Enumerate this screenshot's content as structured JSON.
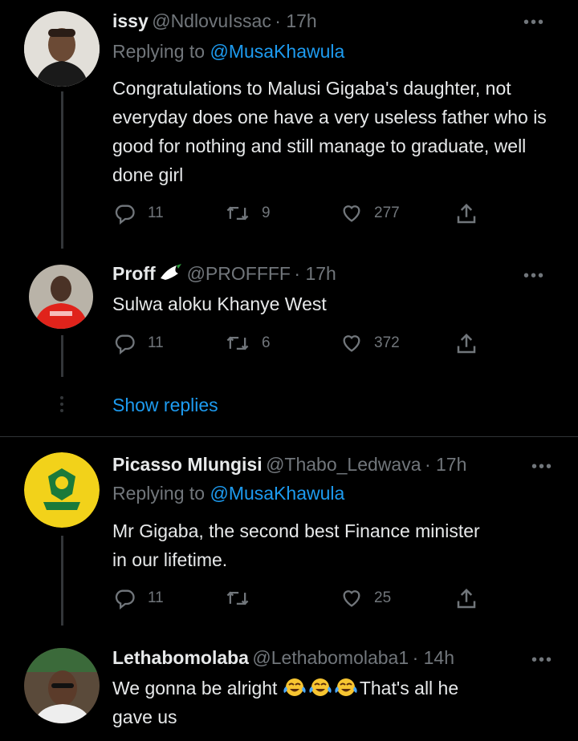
{
  "tweets": [
    {
      "name": "issy",
      "handle": "@NdlovuIssac",
      "time": "· 17h",
      "replying_prefix": "Replying to ",
      "replying_to": "@MusaKhawula",
      "text": "Congratulations to Malusi Gigaba's daughter, not everyday does one have a very useless father who is good for nothing and still manage to graduate, well done girl",
      "reply_count": "11",
      "retweet_count": "9",
      "like_count": "277"
    },
    {
      "name": "Proff",
      "handle": "@PROFFFF",
      "time": "· 17h",
      "text": "Sulwa aloku Khanye West",
      "reply_count": "11",
      "retweet_count": "6",
      "like_count": "372"
    },
    {
      "name": "Picasso Mlungisi",
      "handle": "@Thabo_Ledwava",
      "time": "· 17h",
      "replying_prefix": "Replying to ",
      "replying_to": "@MusaKhawula",
      "text": "Mr Gigaba, the second best Finance minister in our lifetime.",
      "reply_count": "11",
      "retweet_count": "",
      "like_count": "25"
    },
    {
      "name": "Lethabomolaba",
      "handle": "@Lethabomolaba1",
      "time": "· 14h",
      "text_before": "We gonna be alright ",
      "text_after": "That's all he",
      "text_line2": "gave us",
      "emoji": "face-with-tears-of-joy"
    }
  ],
  "show_replies": "Show replies",
  "more_label": "•••",
  "colors": {
    "background": "#000000",
    "text": "#e7e9ea",
    "secondary": "#71767b",
    "link": "#1d9bf0",
    "line": "#333639"
  }
}
